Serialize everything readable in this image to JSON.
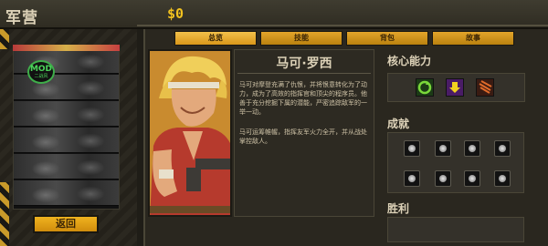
{
  "header": {
    "title": "军营",
    "money": "$0"
  },
  "roster": {
    "badge_text": "MOD",
    "badge_sub": "二战风",
    "back_label": "返回"
  },
  "tabs": [
    {
      "label": "总览",
      "active": true
    },
    {
      "label": "技能",
      "active": false
    },
    {
      "label": "背包",
      "active": false
    },
    {
      "label": "故事",
      "active": false
    }
  ],
  "hero": {
    "name": "马可·罗西",
    "bio_1": "马可对摩登充满了仇恨，并将恨意转化为了动力，成为了高效的指挥官和顶尖的程序员。他善于充分挖掘下属的潜能，严密追踪敌军的一举一动。",
    "bio_2": "马可运筹帷幄，指挥友军火力全开，并从战处掌控敌人。"
  },
  "side": {
    "core_title": "核心能力",
    "achievements_title": "成就",
    "wins_title": "胜利"
  },
  "colors": {
    "accent": "#e3a52b",
    "money": "#f2c21f",
    "mod_green": "#4bd55a"
  },
  "icons": {
    "skills": [
      "reload-skill-icon",
      "airstrike-skill-icon",
      "claw-skill-icon"
    ]
  }
}
